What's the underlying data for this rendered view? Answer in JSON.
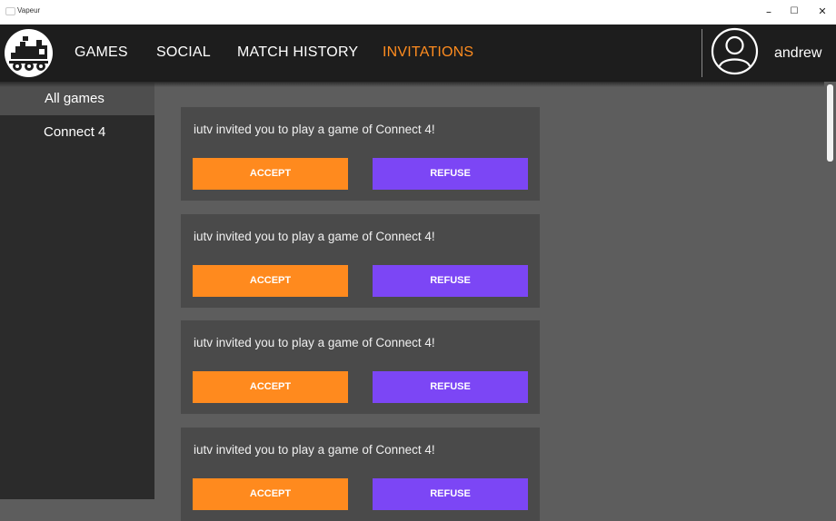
{
  "window": {
    "title": "Vapeur",
    "minimize": "–",
    "maximize": "☐",
    "close": "✕"
  },
  "nav": {
    "items": [
      {
        "label": "GAMES"
      },
      {
        "label": "SOCIAL"
      },
      {
        "label": "MATCH HISTORY"
      },
      {
        "label": "INVITATIONS",
        "active": true
      }
    ],
    "username": "andrew"
  },
  "sidebar": {
    "items": [
      {
        "label": "All games",
        "selected": true
      },
      {
        "label": "Connect 4"
      }
    ]
  },
  "invitations": [
    {
      "message": "iutv invited you to play a game of Connect 4!",
      "accept_label": "ACCEPT",
      "refuse_label": "REFUSE"
    },
    {
      "message": "iutv invited you to play a game of Connect 4!",
      "accept_label": "ACCEPT",
      "refuse_label": "REFUSE"
    },
    {
      "message": "iutv invited you to play a game of Connect 4!",
      "accept_label": "ACCEPT",
      "refuse_label": "REFUSE"
    },
    {
      "message": "iutv invited you to play a game of Connect 4!",
      "accept_label": "ACCEPT",
      "refuse_label": "REFUSE"
    }
  ],
  "colors": {
    "accent": "#ff8c1f",
    "accept": "#ff8a1e",
    "refuse": "#7c46f5",
    "navbar": "#1d1d1d",
    "sidebar": "#2b2b2b",
    "content": "#5d5d5d",
    "card": "#4a4a4a"
  },
  "icons": {
    "logo": "locomotive-logo-icon",
    "avatar": "user-profile-icon"
  }
}
